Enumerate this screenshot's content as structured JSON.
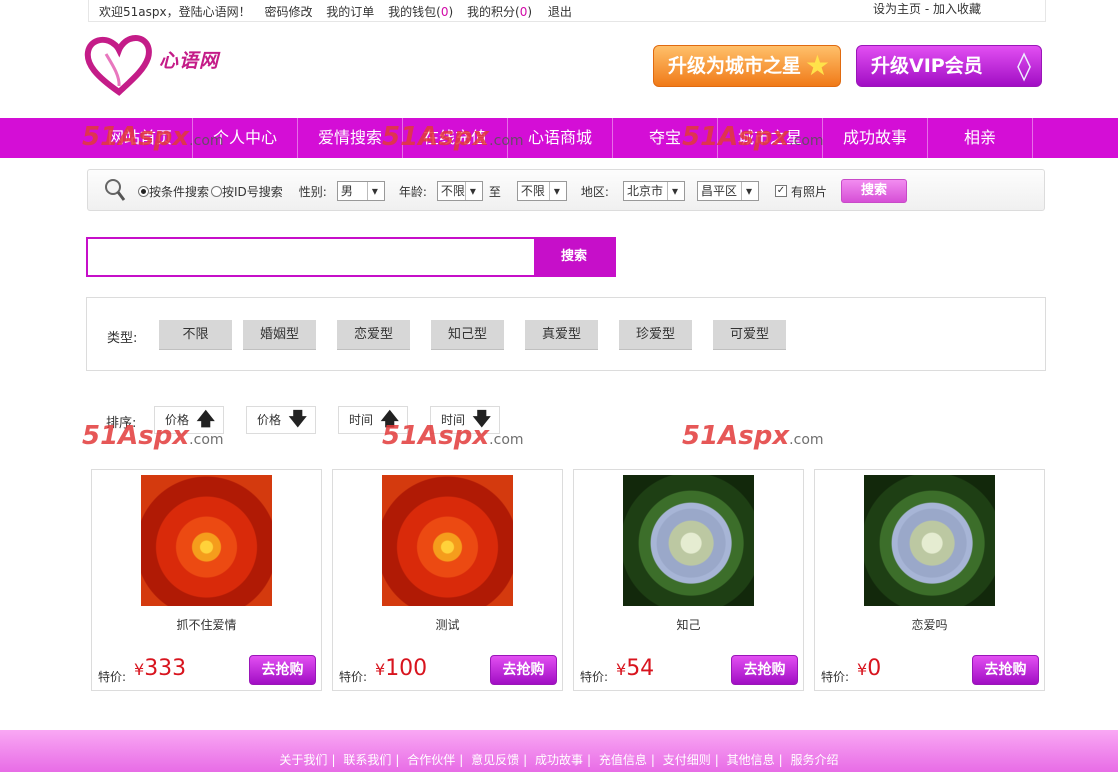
{
  "topbar": {
    "welcome": "欢迎51aspx，登陆心语网！",
    "password_change": "密码修改",
    "my_orders": "我的订单",
    "my_wallet": "我的钱包",
    "wallet_count": "0",
    "my_points": "我的积分",
    "points_count": "0",
    "logout": "退出",
    "set_homepage": "设为主页",
    "separator": "-",
    "add_favorite": "加入收藏"
  },
  "header": {
    "logo_text": "心语网",
    "upgrade_city_label": "升级为城市之星",
    "upgrade_vip_label": "升级VIP会员"
  },
  "nav": {
    "items": [
      "网站首页",
      "个人中心",
      "爱情搜索",
      "在线充值",
      "心语商城",
      "夺宝",
      "城市之星",
      "成功故事",
      "相亲"
    ]
  },
  "watermark": {
    "text": "51Aspx",
    "suffix": ".com"
  },
  "search_bar": {
    "radio_condition": "按条件搜索",
    "radio_id": "按ID号搜索",
    "gender_label": "性别:",
    "gender_value": "男",
    "age_label": "年龄:",
    "age_from": "不限",
    "age_to_label": "至",
    "age_to": "不限",
    "region_label": "地区:",
    "city": "北京市",
    "district": "昌平区",
    "has_photo_label": "有照片",
    "search_button": "搜索"
  },
  "big_search": {
    "placeholder": "",
    "button": "搜索"
  },
  "type_filter": {
    "label": "类型:",
    "options": [
      "不限",
      "婚姻型",
      "恋爱型",
      "知己型",
      "真爱型",
      "珍爱型",
      "可爱型"
    ]
  },
  "sort": {
    "label": "排序:",
    "options": [
      {
        "label": "价格",
        "direction": "up"
      },
      {
        "label": "价格",
        "direction": "down"
      },
      {
        "label": "时间",
        "direction": "up"
      },
      {
        "label": "时间",
        "direction": "down"
      }
    ]
  },
  "products": [
    {
      "name": "抓不住爱情",
      "price_label": "特价:",
      "currency": "¥",
      "price": "333",
      "buy": "去抢购",
      "image": "orange-chrysanthemum"
    },
    {
      "name": "测试",
      "price_label": "特价:",
      "currency": "¥",
      "price": "100",
      "buy": "去抢购",
      "image": "orange-chrysanthemum"
    },
    {
      "name": "知己",
      "price_label": "特价:",
      "currency": "¥",
      "price": "54",
      "buy": "去抢购",
      "image": "hydrangea"
    },
    {
      "name": "恋爱吗",
      "price_label": "特价:",
      "currency": "¥",
      "price": "0",
      "buy": "去抢购",
      "image": "hydrangea"
    }
  ],
  "footer": {
    "links": [
      "关于我们",
      "联系我们",
      "合作伙伴",
      "意见反馈",
      "成功故事",
      "充值信息",
      "支付细则",
      "其他信息",
      "服务介绍"
    ]
  },
  "colors": {
    "brand_magenta": "#d40ed6",
    "price_red": "#d8141e",
    "footer_pink": "#e86ce6"
  }
}
